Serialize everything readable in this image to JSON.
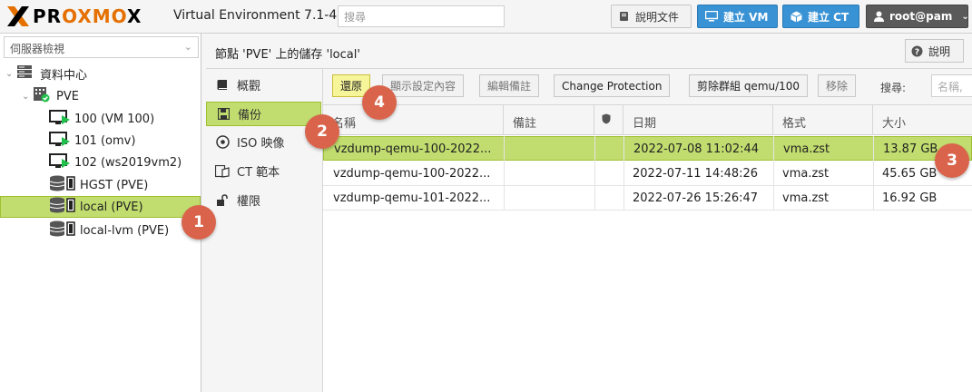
{
  "app": {
    "logo_text_a": "PR",
    "logo_text_b": "OXMO",
    "logo_text_c": "X",
    "version": "Virtual Environment 7.1-4",
    "search_placeholder": "搜尋",
    "docs_label": "說明文件",
    "create_vm_label": "建立 VM",
    "create_ct_label": "建立 CT",
    "user_label": "root@pam"
  },
  "left": {
    "view": "伺服器檢視",
    "tree": [
      {
        "label": "資料中心",
        "icon": "datacenter-icon"
      },
      {
        "label": "PVE",
        "icon": "node-icon"
      },
      {
        "label": "100 (VM 100)",
        "icon": "vm-running-icon"
      },
      {
        "label": "101 (omv)",
        "icon": "vm-running-icon"
      },
      {
        "label": "102 (ws2019vm2)",
        "icon": "vm-running-icon"
      },
      {
        "label": "HGST (PVE)",
        "icon": "storage-icon"
      },
      {
        "label": "local (PVE)",
        "icon": "storage-icon",
        "selected": true
      },
      {
        "label": "local-lvm (PVE)",
        "icon": "storage-icon"
      }
    ]
  },
  "header": {
    "title": "節點 'PVE' 上的儲存 'local'",
    "help_label": "說明"
  },
  "menu": [
    {
      "label": "概觀",
      "icon": "book-icon"
    },
    {
      "label": "備份",
      "icon": "floppy-icon",
      "selected": true
    },
    {
      "label": "ISO 映像",
      "icon": "disc-icon"
    },
    {
      "label": "CT 範本",
      "icon": "template-icon"
    },
    {
      "label": "權限",
      "icon": "unlock-icon"
    }
  ],
  "toolbar": {
    "restore": "還原",
    "show_config": "顯示設定內容",
    "edit_notes": "編輯備註",
    "change_protection": "Change Protection",
    "prune_group": "剪除群組 qemu/100",
    "remove": "移除",
    "search_label": "搜尋:",
    "search_placeholder": "名稱,"
  },
  "grid": {
    "columns": [
      "名稱",
      "備註",
      "",
      "日期",
      "格式",
      "大小"
    ],
    "rows": [
      {
        "name": "vzdump-qemu-100-2022...",
        "notes": "",
        "date": "2022-07-08 11:02:44",
        "format": "vma.zst",
        "size": "13.87 GB",
        "selected": true
      },
      {
        "name": "vzdump-qemu-100-2022...",
        "notes": "",
        "date": "2022-07-11 14:48:26",
        "format": "vma.zst",
        "size": "45.65 GB"
      },
      {
        "name": "vzdump-qemu-101-2022...",
        "notes": "",
        "date": "2022-07-26 15:26:47",
        "format": "vma.zst",
        "size": "16.92 GB"
      }
    ]
  },
  "callouts": [
    "1",
    "2",
    "3",
    "4"
  ]
}
